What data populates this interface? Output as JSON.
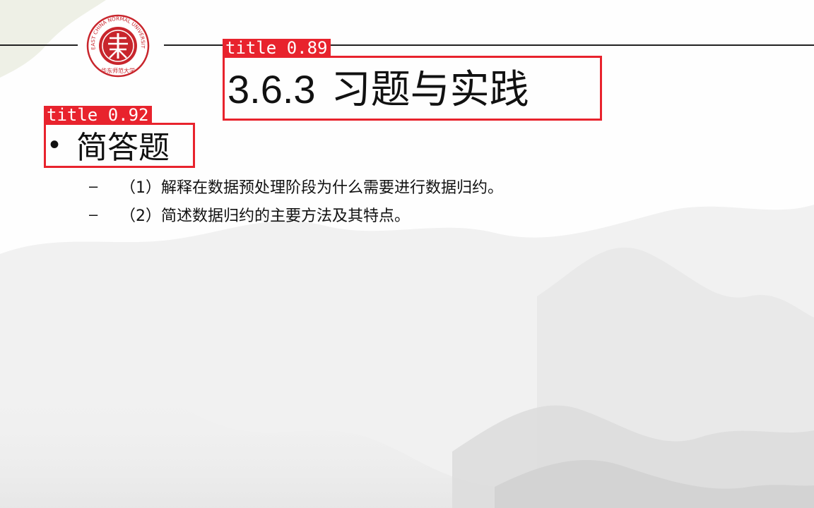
{
  "slide": {
    "title_number": "3.6.3",
    "title_text": "习题与实践",
    "bullet_heading": "简答题",
    "items": [
      {
        "dash": "–",
        "text": "（1）解释在数据预处理阶段为什么需要进行数据归约。"
      },
      {
        "dash": "–",
        "text": "（2）简述数据归约的主要方法及其特点。"
      }
    ]
  },
  "logo": {
    "ring_text": "EAST CHINA NORMAL UNIVERSITY",
    "bottom_text": "华东师范大学"
  },
  "detections": [
    {
      "label": "title 0.89"
    },
    {
      "label": "title 0.92"
    }
  ],
  "colors": {
    "detection_red": "#e8232d",
    "logo_red": "#c8252c"
  }
}
